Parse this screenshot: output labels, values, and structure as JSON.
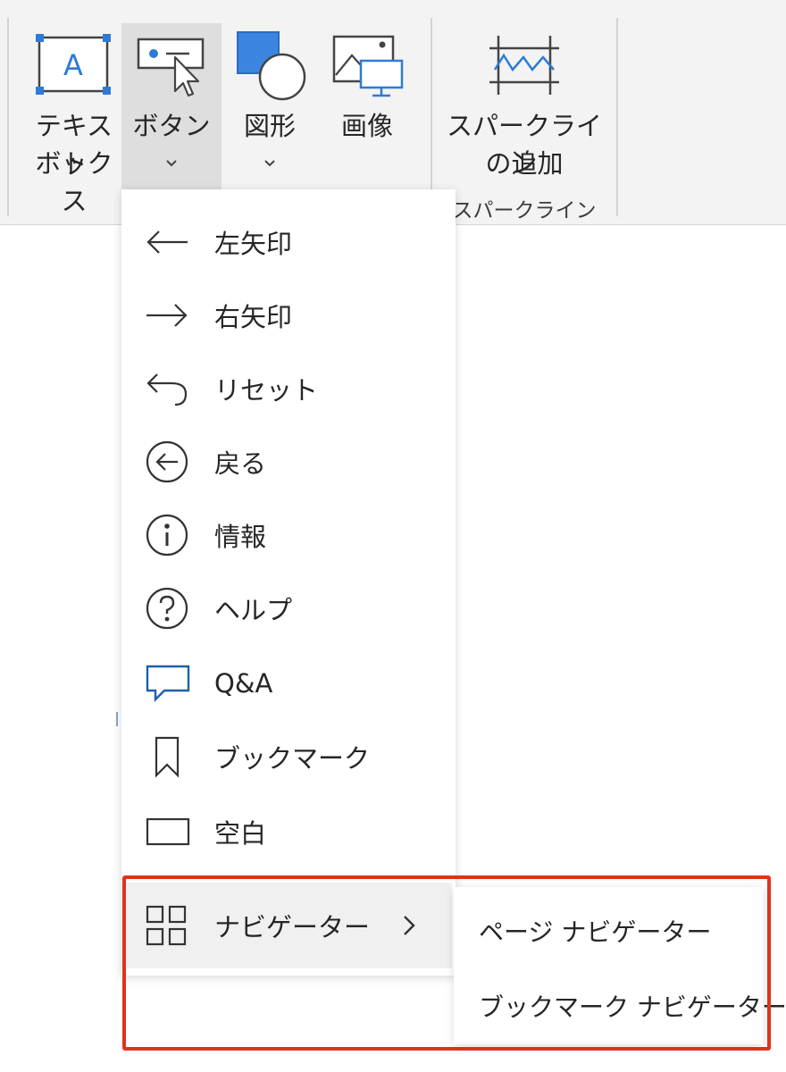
{
  "ribbon": {
    "textbox": {
      "label_line1": "テキスト",
      "label_line2": "ボックス",
      "icon": "textbox-icon"
    },
    "button": {
      "label": "ボタン",
      "icon": "button-cursor-icon",
      "has_dropdown": true
    },
    "shapes": {
      "label": "図形",
      "icon": "shapes-icon",
      "has_dropdown": true
    },
    "image": {
      "label": "画像",
      "icon": "image-icon"
    },
    "sparkline": {
      "label_line1": "スパークライン",
      "label_line2": "の追加",
      "icon": "sparkline-icon"
    },
    "sparkline_group_label": "スパークライン"
  },
  "menu": {
    "items": [
      {
        "label": "左矢印",
        "icon": "left-arrow-icon"
      },
      {
        "label": "右矢印",
        "icon": "right-arrow-icon"
      },
      {
        "label": "リセット",
        "icon": "reset-icon"
      },
      {
        "label": "戻る",
        "icon": "back-circle-icon"
      },
      {
        "label": "情報",
        "icon": "info-icon"
      },
      {
        "label": "ヘルプ",
        "icon": "help-icon"
      },
      {
        "label": "Q&A",
        "icon": "qa-icon"
      },
      {
        "label": "ブックマーク",
        "icon": "bookmark-icon"
      },
      {
        "label": "空白",
        "icon": "blank-icon"
      },
      {
        "label": "ナビゲーター",
        "icon": "navigator-grid-icon",
        "has_submenu": true
      }
    ]
  },
  "submenu": {
    "items": [
      {
        "label": "ページ ナビゲーター"
      },
      {
        "label": "ブックマーク ナビゲーター"
      }
    ]
  },
  "colors": {
    "accent_blue": "#2e7bd6",
    "qa_icon_blue": "#1f5fa8",
    "highlight_red": "#e0321e",
    "ribbon_bg": "#f3f3f3"
  }
}
